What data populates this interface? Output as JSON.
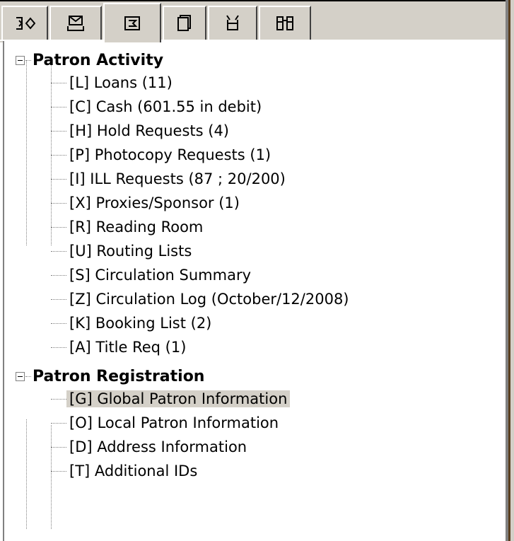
{
  "tabs": [
    {
      "icon": "patron-transfer-icon",
      "active": false
    },
    {
      "icon": "envelope-tray-icon",
      "active": false
    },
    {
      "icon": "patron-card-icon",
      "active": true
    },
    {
      "icon": "notebook-icon",
      "active": false
    },
    {
      "icon": "basket-icon",
      "active": false
    },
    {
      "icon": "binoculars-icon",
      "active": false
    }
  ],
  "tree": {
    "patron_activity": {
      "label": "Patron Activity",
      "expanded": true,
      "items": [
        {
          "label": "[L] Loans (11)"
        },
        {
          "label": "[C] Cash (601.55 in debit)"
        },
        {
          "label": "[H] Hold Requests (4)"
        },
        {
          "label": "[P] Photocopy Requests (1)"
        },
        {
          "label": "[I] ILL Requests (87 ; 20/200)"
        },
        {
          "label": "[X] Proxies/Sponsor (1)"
        },
        {
          "label": "[R] Reading Room"
        },
        {
          "label": "[U] Routing Lists"
        },
        {
          "label": "[S] Circulation Summary"
        },
        {
          "label": "[Z] Circulation Log (October/12/2008)"
        },
        {
          "label": "[K] Booking List (2)"
        },
        {
          "label": "[A] Title Req (1)"
        }
      ]
    },
    "patron_registration": {
      "label": "Patron Registration",
      "expanded": true,
      "items": [
        {
          "label": "[G] Global Patron Information",
          "selected": true
        },
        {
          "label": "[O] Local Patron Information"
        },
        {
          "label": "[D] Address Information"
        },
        {
          "label": "[T] Additional IDs"
        }
      ]
    }
  }
}
